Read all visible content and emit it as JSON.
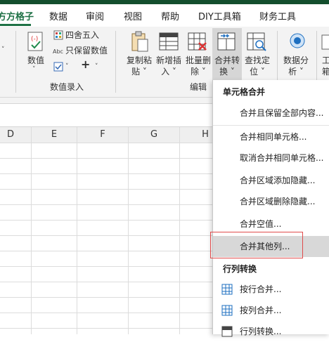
{
  "tabs": [
    {
      "label": "方方格子",
      "active": true
    },
    {
      "label": "数据"
    },
    {
      "label": "审阅"
    },
    {
      "label": "视图"
    },
    {
      "label": "帮助"
    },
    {
      "label": "DIY工具箱"
    },
    {
      "label": "财务工具"
    }
  ],
  "ribbon": {
    "numeric_group": {
      "value_button": "数值",
      "round_label": "四舍五入",
      "keep_value_label": "只保留数值",
      "plus_label": "+",
      "group_label": "数值录入"
    },
    "edit_group": {
      "copy_paste": [
        "复制粘",
        "贴"
      ],
      "add_insert": [
        "新增插",
        "入"
      ],
      "batch_delete": [
        "批量删",
        "除"
      ],
      "merge_convert": [
        "合并转",
        "换"
      ],
      "find_locate": [
        "查找定",
        "位"
      ],
      "group_label": "编辑"
    },
    "analysis": {
      "label": [
        "数据分",
        "析"
      ]
    },
    "partial_right": {
      "label": [
        "工",
        "箱"
      ]
    }
  },
  "columns": [
    "D",
    "E",
    "F",
    "G",
    "H"
  ],
  "menu": {
    "section1": "单元格合并",
    "items1": [
      "合并且保留全部内容...",
      "合并相同单元格...",
      "取消合并相同单元格...",
      "合并区域添加隐藏...",
      "合并区域删除隐藏...",
      "合并空值...",
      "合并其他列..."
    ],
    "section2": "行列转换",
    "items2": [
      "按行合并...",
      "按列合并...",
      "行列转换..."
    ]
  }
}
